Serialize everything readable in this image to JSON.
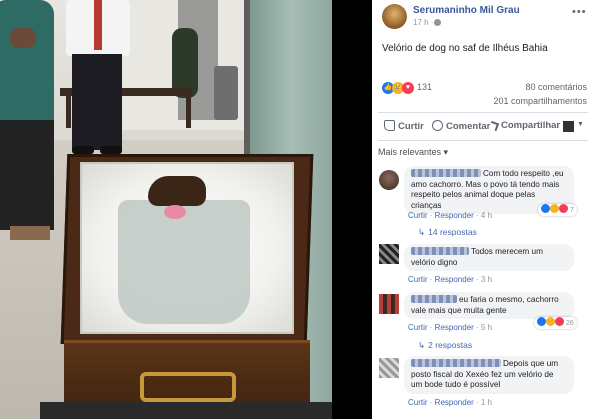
{
  "post": {
    "page_name": "Serumaninho Mil Grau",
    "time": "17 h ·",
    "text": "Velório de dog no saf de Ilhéus Bahia",
    "more_icon": "more-icon",
    "reaction_count": "131",
    "comments": "80 comentários",
    "shares": "201 compartilhamentos"
  },
  "actions": {
    "like": "Curtir",
    "comment": "Comentar",
    "share": "Compartilhar"
  },
  "relevance_filter": "Mais relevantes ▾",
  "comments": [
    {
      "text": "Com todo respeito ,eu amo cachorro. Mas o povo tá tendo mais respeito pelos animal doque pelas crianças",
      "like": "Curtir",
      "reply": "Responder",
      "time": "4 h",
      "reaction_count": "7",
      "replies": "14 respostas"
    },
    {
      "text": "Todos merecem um velório digno",
      "like": "Curtir",
      "reply": "Responder",
      "time": "3 h"
    },
    {
      "text": "eu faria o mesmo, cachorro vale mais que muita gente",
      "like": "Curtir",
      "reply": "Responder",
      "time": "5 h",
      "reaction_count": "26",
      "replies": "2 respostas"
    },
    {
      "text": "Depois que um posto fiscal do Xexéo fez um velório de um bode tudo é possível",
      "like": "Curtir",
      "reply": "Responder",
      "time": "1 h"
    }
  ],
  "colors": {
    "link_blue": "#385898",
    "like_blue": "#1877f2",
    "love_red": "#f33e58",
    "haha_yellow": "#f7b125"
  }
}
